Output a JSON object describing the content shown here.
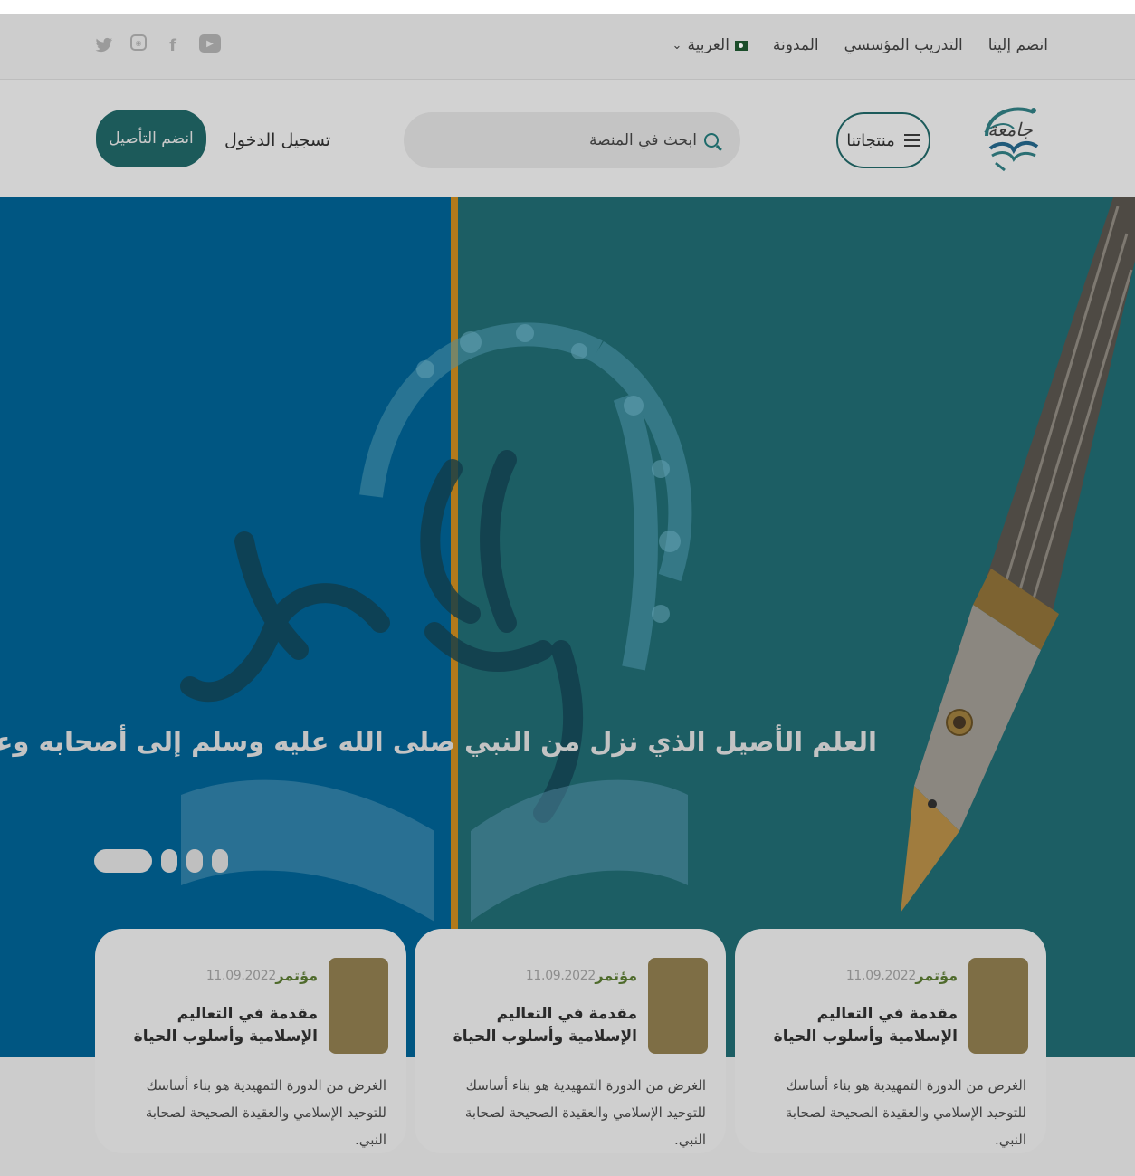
{
  "topbar": {
    "links": [
      "انضم إلينا",
      "التدريب المؤسسي",
      "المدونة"
    ],
    "language": "العربية",
    "social_icons": [
      "twitter-icon",
      "instagram-icon",
      "facebook-icon",
      "youtube-icon"
    ]
  },
  "header": {
    "logo_alt": "جامعة التأصيل",
    "menu_label": "منتجاتنا",
    "search_placeholder": "ابحث في المنصة",
    "login_label": "تسجيل الدخول",
    "join_label": "انضم التأصيل"
  },
  "hero": {
    "title": "العلم الأصيل الذي نزل من النبي صلى الله عليه وسلم إلى أصحابه وعلماء هذه الأمة",
    "slide_count": 4,
    "active_slide": 1,
    "colors": {
      "left": "#005682",
      "right": "#1c5e64",
      "stripe": "#b27a1b"
    }
  },
  "cards": [
    {
      "tag": "مؤتمر",
      "date": "11.09.2022",
      "title": "مقدمة في التعاليم الإسلامية وأسلوب الحياة",
      "description": "الغرض من الدورة التمهيدية هو بناء أساسك للتوحيد الإسلامي والعقيدة الصحيحة لصحابة النبي."
    },
    {
      "tag": "مؤتمر",
      "date": "11.09.2022",
      "title": "مقدمة في التعاليم الإسلامية وأسلوب الحياة",
      "description": "الغرض من الدورة التمهيدية هو بناء أساسك للتوحيد الإسلامي والعقيدة الصحيحة لصحابة النبي."
    },
    {
      "tag": "مؤتمر",
      "date": "11.09.2022",
      "title": "مقدمة في التعاليم الإسلامية وأسلوب الحياة",
      "description": "الغرض من الدورة التمهيدية هو بناء أساسك للتوحيد الإسلامي والعقيدة الصحيحة لصحابة النبي."
    }
  ]
}
